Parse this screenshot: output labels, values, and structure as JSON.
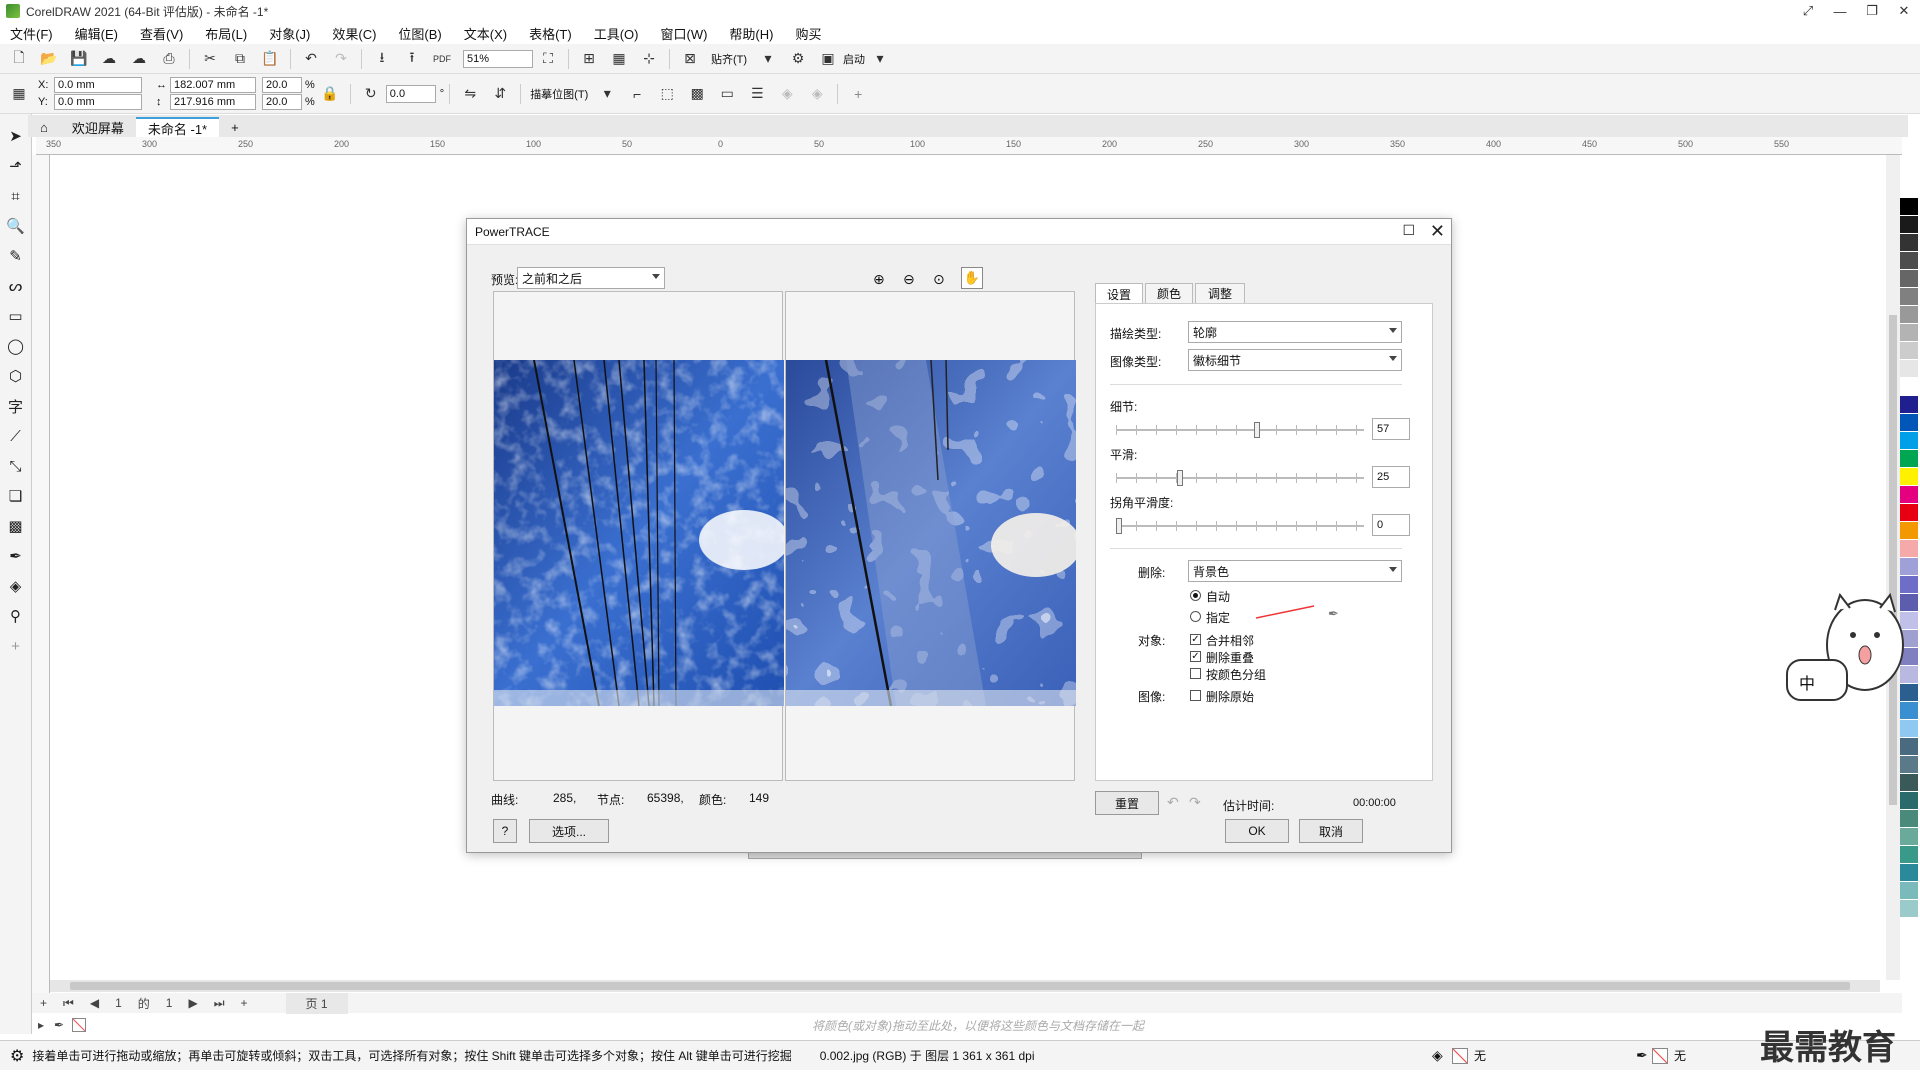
{
  "window": {
    "title": "CorelDRAW 2021 (64-Bit 评估版) - 未命名 -1*"
  },
  "menu": [
    "文件(F)",
    "编辑(E)",
    "查看(V)",
    "布局(L)",
    "对象(J)",
    "效果(C)",
    "位图(B)",
    "文本(X)",
    "表格(T)",
    "工具(O)",
    "窗口(W)",
    "帮助(H)",
    "购买"
  ],
  "toolbar1": {
    "zoom": "51%",
    "snap_label": "贴齐(T)",
    "launch_label": "启动"
  },
  "toolbar2": {
    "x": "0.0 mm",
    "y": "0.0 mm",
    "width": "182.007 mm",
    "height": "217.916 mm",
    "scale_w": "20.0",
    "scale_h": "20.0",
    "pct1": "%",
    "pct2": "%",
    "rotate": "0.0",
    "degree": "°",
    "trace_label": "描摹位图(T)",
    "x_label": "X:",
    "y_label": "Y:"
  },
  "tabs": {
    "welcome": "欢迎屏幕",
    "doc": "未命名 -1*"
  },
  "ruler": {
    "ticks": [
      "350",
      "300",
      "250",
      "200",
      "150",
      "100",
      "50",
      "0",
      "50",
      "100",
      "150",
      "200",
      "250",
      "300",
      "350",
      "400",
      "450",
      "500",
      "550"
    ]
  },
  "pagenav": {
    "current": "1",
    "of": "的",
    "total": "1",
    "page_tab": "页 1"
  },
  "colorhint": "将颜色(或对象)拖动至此处，以便将这些颜色与文档存储在一起",
  "statusbar": {
    "hint": "接着单击可进行拖动或缩放；再单击可旋转或倾斜；双击工具，可选择所有对象；按住 Shift 键单击可选择多个对象；按住 Alt 键单击可进行挖掘",
    "file_info": "0.002.jpg (RGB) 于 图层 1 361 x 361 dpi",
    "fill_none": "无",
    "outline_none": "无"
  },
  "watermark": "最需教育",
  "mascot_text": "中",
  "dialog": {
    "title": "PowerTRACE",
    "preview_label": "预览:",
    "preview_value": "之前和之后",
    "tabs": [
      "设置",
      "颜色",
      "调整"
    ],
    "trace_type_label": "描绘类型:",
    "trace_type_value": "轮廓",
    "image_type_label": "图像类型:",
    "image_type_value": "徽标细节",
    "detail_label": "细节:",
    "detail_value": "57",
    "detail_level": 0.57,
    "smooth_label": "平滑:",
    "smooth_value": "25",
    "smooth_level": 0.25,
    "corner_label": "拐角平滑度:",
    "corner_value": "0",
    "corner_level": 0.0,
    "remove_label": "删除:",
    "remove_value": "背景色",
    "auto_label": "自动",
    "specify_label": "指定",
    "object_label": "对象:",
    "merge_label": "合并相邻",
    "merge_checked": true,
    "remove_overlap_label": "删除重叠",
    "remove_overlap_checked": true,
    "group_label": "按颜色分组",
    "group_checked": false,
    "image_label": "图像:",
    "delete_original_label": "删除原始",
    "delete_original_checked": false,
    "curves_label": "曲线:",
    "curves_value": "285,",
    "nodes_label": "节点:",
    "nodes_value": "65398,",
    "colors_label": "颜色:",
    "colors_value": "149",
    "reset_label": "重置",
    "est_time_label": "估计时间:",
    "est_time_value": "00:00:00",
    "help_label": "?",
    "options_label": "选项...",
    "ok_label": "OK",
    "cancel_label": "取消"
  },
  "palette": [
    "#ffffff",
    "#000000",
    "#1a1a1a",
    "#333333",
    "#4d4d4d",
    "#666666",
    "#808080",
    "#999999",
    "#b3b3b3",
    "#cccccc",
    "#e6e6e6",
    "#ffffff",
    "#1f1f8f",
    "#0057b8",
    "#00a0e9",
    "#00a651",
    "#fff100",
    "#e4007f",
    "#e60012",
    "#f39800",
    "#f5a9a9",
    "#9fa0d8",
    "#6e6ec8",
    "#5d5db0",
    "#c0c0e8",
    "#a0a0d0",
    "#8080c0",
    "#b8b8e0",
    "#2b5f8f",
    "#3a8fd0",
    "#8fc8f0",
    "#4a6a80",
    "#5a7a8a",
    "#3a5a5a",
    "#2a6a6a",
    "#4a8a7a",
    "#6aaa9a",
    "#3a9a8a",
    "#2a8a9a",
    "#7ababa",
    "#9acaca"
  ]
}
